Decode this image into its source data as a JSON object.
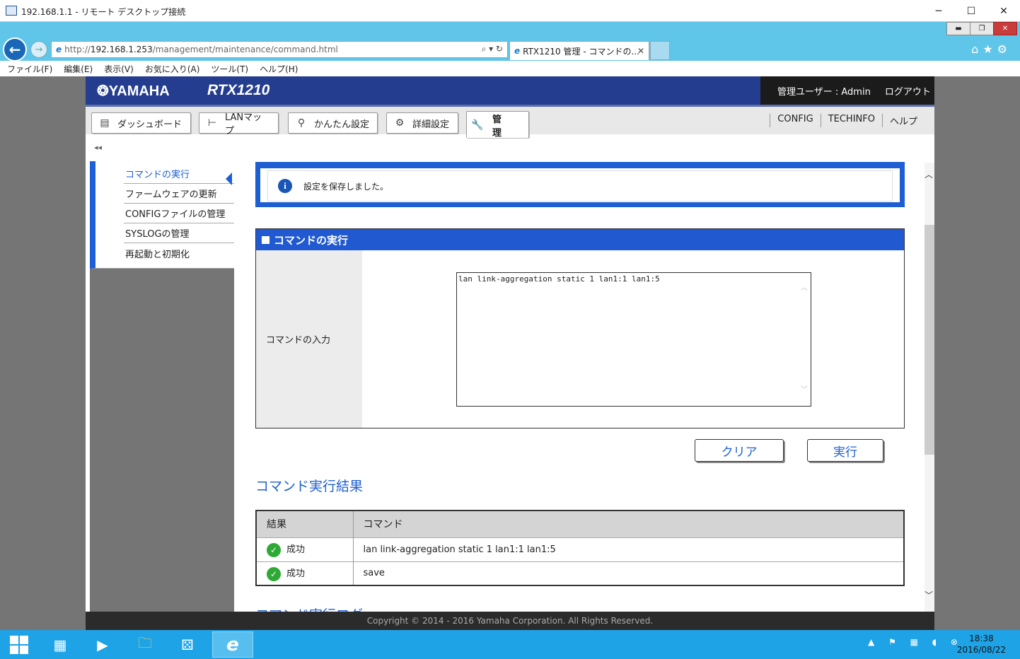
{
  "rdp": {
    "title": "192.168.1.1 - リモート デスクトップ接続",
    "minimize": "─",
    "maximize": "☐",
    "close": "✕",
    "sub_minimize": "▬",
    "sub_restore": "❐",
    "sub_close": "✕"
  },
  "browser": {
    "url_scheme": "http://",
    "url_host": "192.168.1.253",
    "url_path": "/management/maintenance/command.html",
    "url_tools": "⌕ ▾ ↻",
    "tab_title": "RTX1210 管理 - コマンドの...",
    "tab_close": "✕",
    "right_icons": "⌂★⚙",
    "back": "←",
    "forward": "→",
    "ie_glyph": "e",
    "menu": [
      "ファイル(F)",
      "編集(E)",
      "表示(V)",
      "お気に入り(A)",
      "ツール(T)",
      "ヘルプ(H)"
    ]
  },
  "header": {
    "brand": "❂YAMAHA",
    "model": "RTX1210",
    "user_label": "管理ユーザー : Admin",
    "logout": "ログアウト"
  },
  "nav": {
    "tabs": [
      {
        "label": "ダッシュボード",
        "icon": "dashboard-icon"
      },
      {
        "label": "LANマップ",
        "icon": "lanmap-icon"
      },
      {
        "label": "かんたん設定",
        "icon": "wand-icon"
      },
      {
        "label": "詳細設定",
        "icon": "gear-icon"
      },
      {
        "label": "管 理",
        "icon": "wrench-icon"
      }
    ],
    "icon_glyphs": [
      "▤",
      "⊢",
      "⚲",
      "⚙",
      "🔧"
    ],
    "links": [
      "CONFIG",
      "TECHINFO",
      "ヘルプ"
    ],
    "collapse": "◂◂"
  },
  "sidebar": {
    "items": [
      {
        "label": "コマンドの実行",
        "active": true
      },
      {
        "label": "ファームウェアの更新"
      },
      {
        "label": "CONFIGファイルの管理"
      },
      {
        "label": "SYSLOGの管理"
      },
      {
        "label": "再起動と初期化"
      }
    ]
  },
  "notice": {
    "icon": "i",
    "text": "設定を保存しました。"
  },
  "command": {
    "section_title": "コマンドの実行",
    "input_label": "コマンドの入力",
    "input_value": "lan link-aggregation static 1 lan1:1 lan1:5",
    "scroll_up": "︿",
    "scroll_down": "﹀",
    "clear_button": "クリア",
    "run_button": "実行"
  },
  "results": {
    "title": "コマンド実行結果",
    "columns": [
      "結果",
      "コマンド"
    ],
    "check_glyph": "✓",
    "rows": [
      {
        "status": "成功",
        "command": "lan link-aggregation static 1 lan1:1 lan1:5"
      },
      {
        "status": "成功",
        "command": "save"
      }
    ]
  },
  "log": {
    "title": "コマンド実行ログ"
  },
  "scrollbar": {
    "up": "︿",
    "down": "﹀"
  },
  "footer": "Copyright © 2014 - 2016 Yamaha Corporation. All Rights Reserved.",
  "taskbar": {
    "tray": "▲ ⚑ ▦ ◖ ⊗",
    "time": "18:38",
    "date": "2016/08/22",
    "icons": [
      "server-manager-icon",
      "powershell-icon",
      "explorer-icon",
      "rdp-icon",
      "ie-icon"
    ],
    "glyphs": [
      "▦",
      "▶",
      "🗀",
      "⚄",
      "e"
    ]
  },
  "colors": {
    "accent": "#1d5fd3",
    "header_bg": "#243d8e",
    "ie_chrome": "#5fc6ea",
    "taskbar": "#1ea3e6",
    "success": "#2fa936"
  }
}
